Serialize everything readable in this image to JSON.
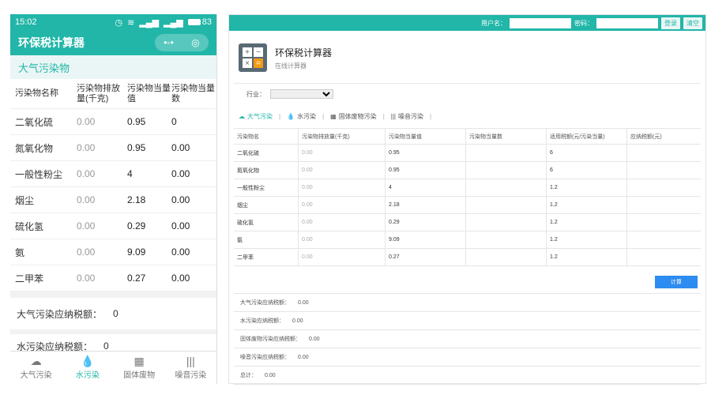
{
  "mobile": {
    "status": {
      "time": "15:02",
      "battery": "83"
    },
    "title": "环保税计算器",
    "section": "大气污染物",
    "headers": [
      "污染物名称",
      "污染物排放量(千克)",
      "污染物当量值",
      "污染物当量数"
    ],
    "rows": [
      {
        "name": "二氧化硫",
        "amount": "0.00",
        "value": "0.95",
        "count": "0"
      },
      {
        "name": "氮氧化物",
        "amount": "0.00",
        "value": "0.95",
        "count": "0.00"
      },
      {
        "name": "一般性粉尘",
        "amount": "0.00",
        "value": "4",
        "count": "0.00"
      },
      {
        "name": "烟尘",
        "amount": "0.00",
        "value": "2.18",
        "count": "0.00"
      },
      {
        "name": "硫化氢",
        "amount": "0.00",
        "value": "0.29",
        "count": "0.00"
      },
      {
        "name": "氨",
        "amount": "0.00",
        "value": "9.09",
        "count": "0.00"
      },
      {
        "name": "二甲苯",
        "amount": "0.00",
        "value": "0.27",
        "count": "0.00"
      }
    ],
    "sum_air_label": "大气污染应纳税额：",
    "sum_air_value": "0",
    "sum_water_label": "水污染应纳税额：",
    "sum_water_value": "0",
    "tabs": [
      "大气污染",
      "水污染",
      "固体废物",
      "噪音污染"
    ],
    "active_tab": 1
  },
  "desktop": {
    "user_label": "用户名：",
    "pwd_label": "密码：",
    "login": "登录",
    "clear": "清空",
    "title": "环保税计算器",
    "subtitle": "在线计算器",
    "industry_label": "行业：",
    "tabs": [
      "大气污染",
      "水污染",
      "固体废物污染",
      "噪音污染"
    ],
    "headers": [
      "污染物名",
      "污染物排放量(千克)",
      "污染物当量值",
      "污染物当量数",
      "适用税额(元/污染当量)",
      "应纳税额(元)"
    ],
    "rows": [
      {
        "name": "二氧化硫",
        "amount": "0.00",
        "value": "0.95",
        "rate": "6"
      },
      {
        "name": "氮氧化物",
        "amount": "0.00",
        "value": "0.95",
        "rate": "6"
      },
      {
        "name": "一般性粉尘",
        "amount": "0.00",
        "value": "4",
        "rate": "1.2"
      },
      {
        "name": "烟尘",
        "amount": "0.00",
        "value": "2.18",
        "rate": "1.2"
      },
      {
        "name": "硫化氢",
        "amount": "0.00",
        "value": "0.29",
        "rate": "1.2"
      },
      {
        "name": "氨",
        "amount": "0.00",
        "value": "9.09",
        "rate": "1.2"
      },
      {
        "name": "二甲苯",
        "amount": "0.00",
        "value": "0.27",
        "rate": "1.2"
      }
    ],
    "calc_button": "计算",
    "summary": [
      {
        "label": "大气污染应纳税额：",
        "value": "0.00"
      },
      {
        "label": "水污染应纳税额：",
        "value": "0.00"
      },
      {
        "label": "固体废物污染应纳税额：",
        "value": "0.00"
      },
      {
        "label": "噪音污染应纳税额：",
        "value": "0.00"
      },
      {
        "label": "总计：",
        "value": "0.00"
      }
    ]
  }
}
